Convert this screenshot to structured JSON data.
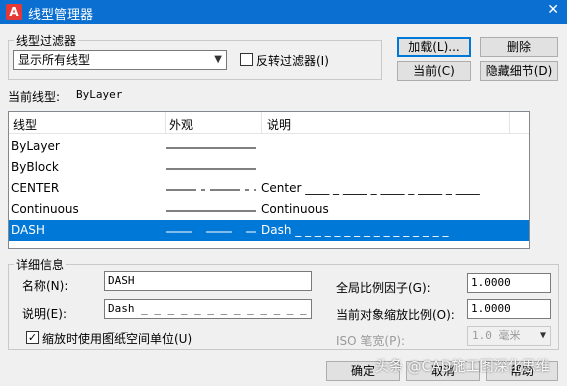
{
  "window": {
    "title": "线型管理器",
    "app_icon_letter": "A",
    "close_glyph": "✕"
  },
  "filter": {
    "group_label": "线型过滤器",
    "selected": "显示所有线型",
    "invert_label": "反转过滤器(I)",
    "invert_checked": false
  },
  "buttons": {
    "load": "加载(L)...",
    "delete": "删除",
    "current": "当前(C)",
    "hide_details": "隐藏细节(D)",
    "ok": "确定",
    "cancel": "取消",
    "help": "帮助"
  },
  "current_linetype": {
    "label": "当前线型:",
    "value": "ByLayer"
  },
  "table": {
    "headers": [
      "线型",
      "外观",
      "说明"
    ],
    "rows": [
      {
        "name": "ByLayer",
        "pattern": "solid",
        "desc": ""
      },
      {
        "name": "ByBlock",
        "pattern": "solid",
        "desc": ""
      },
      {
        "name": "CENTER",
        "pattern": "center",
        "desc": "Center ____ _ ____ _ ____ _ ____ _ ____"
      },
      {
        "name": "Continuous",
        "pattern": "solid",
        "desc": "Continuous"
      },
      {
        "name": "DASH",
        "pattern": "dash",
        "desc": "Dash _ _ _ _ _ _ _ _ _ _ _ _ _ _ _ _",
        "selected": true
      }
    ]
  },
  "details": {
    "group_label": "详细信息",
    "name_label": "名称(N):",
    "name_value": "DASH",
    "desc_label": "说明(E):",
    "desc_value": "Dash _ _ _ _ _ _ _ _ _ _ _ _ _ _ _",
    "paper_units_label": "缩放时使用图纸空间单位(U)",
    "paper_units_checked": true,
    "global_scale_label": "全局比例因子(G):",
    "global_scale_value": "1.0000",
    "current_scale_label": "当前对象缩放比例(O):",
    "current_scale_value": "1.0000",
    "iso_pen_label": "ISO 笔宽(P):",
    "iso_pen_value": "1.0 毫米"
  },
  "watermark": "头条 @CAD施工图深化思维",
  "colors": {
    "titlebar": "#0b6fd1",
    "selection": "#0078d7"
  }
}
